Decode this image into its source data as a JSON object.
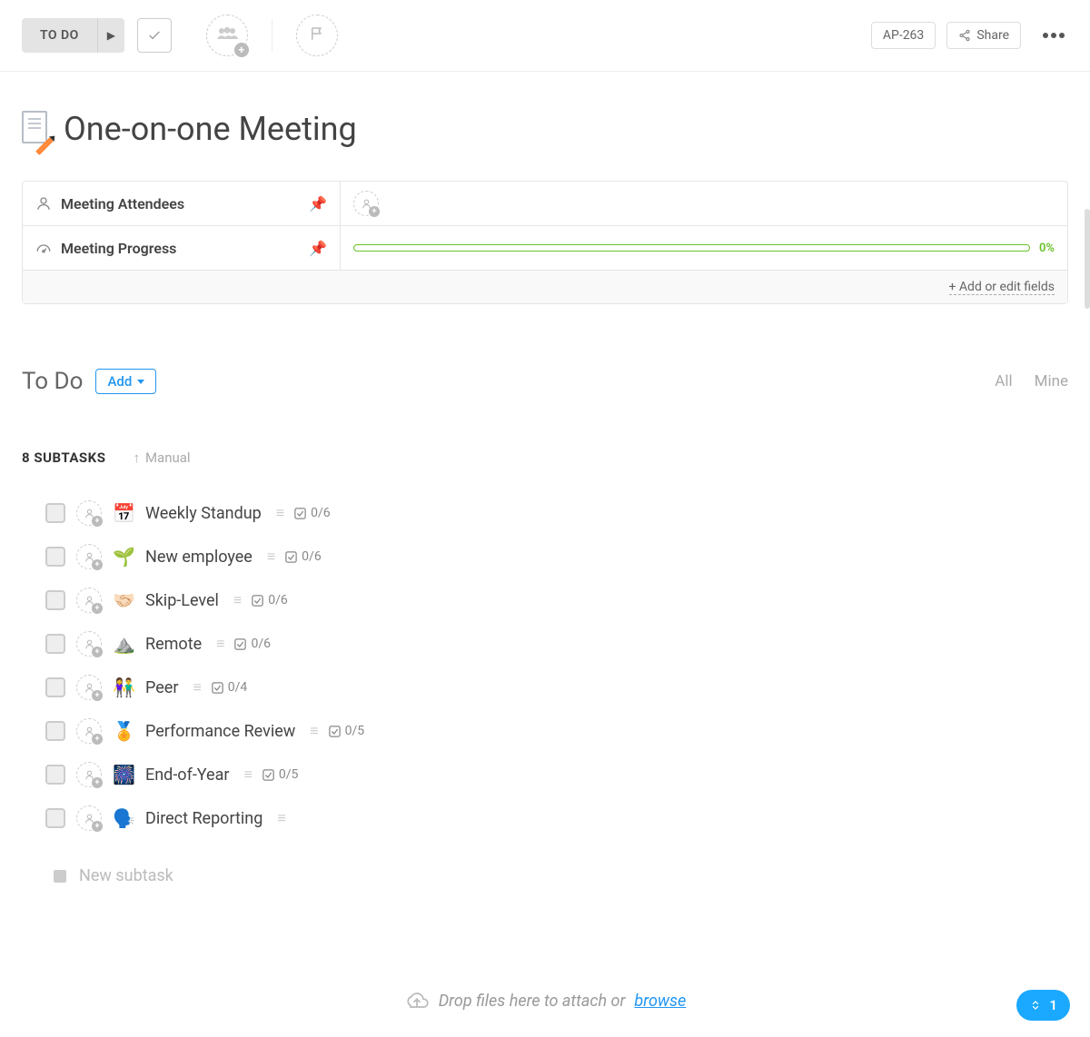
{
  "toolbar": {
    "status": "TO DO",
    "task_id": "AP-263",
    "share": "Share"
  },
  "title": "One-on-one Meeting",
  "fields": {
    "attendees_label": "Meeting Attendees",
    "progress_label": "Meeting Progress",
    "progress_pct": "0%",
    "add_fields": "+ Add or edit fields"
  },
  "todo": {
    "heading": "To Do",
    "add": "Add",
    "all": "All",
    "mine": "Mine",
    "subtask_count": "8 SUBTASKS",
    "sort": "Manual",
    "new_placeholder": "New subtask"
  },
  "subtasks": [
    {
      "emoji": "📅",
      "name": "Weekly Standup",
      "count": "0/6"
    },
    {
      "emoji": "🌱",
      "name": "New employee",
      "count": "0/6"
    },
    {
      "emoji": "🤝🏻",
      "name": "Skip-Level",
      "count": "0/6"
    },
    {
      "emoji": "⛰️",
      "name": "Remote",
      "count": "0/6"
    },
    {
      "emoji": "👫",
      "name": "Peer",
      "count": "0/4"
    },
    {
      "emoji": "🏅",
      "name": "Performance Review",
      "count": "0/5"
    },
    {
      "emoji": "🎆",
      "name": "End-of-Year",
      "count": "0/5"
    },
    {
      "emoji": "🗣️",
      "name": "Direct Reporting",
      "count": ""
    }
  ],
  "dropzone": {
    "text": "Drop files here to attach or ",
    "browse": "browse"
  },
  "expand_pill": {
    "count": "1"
  }
}
